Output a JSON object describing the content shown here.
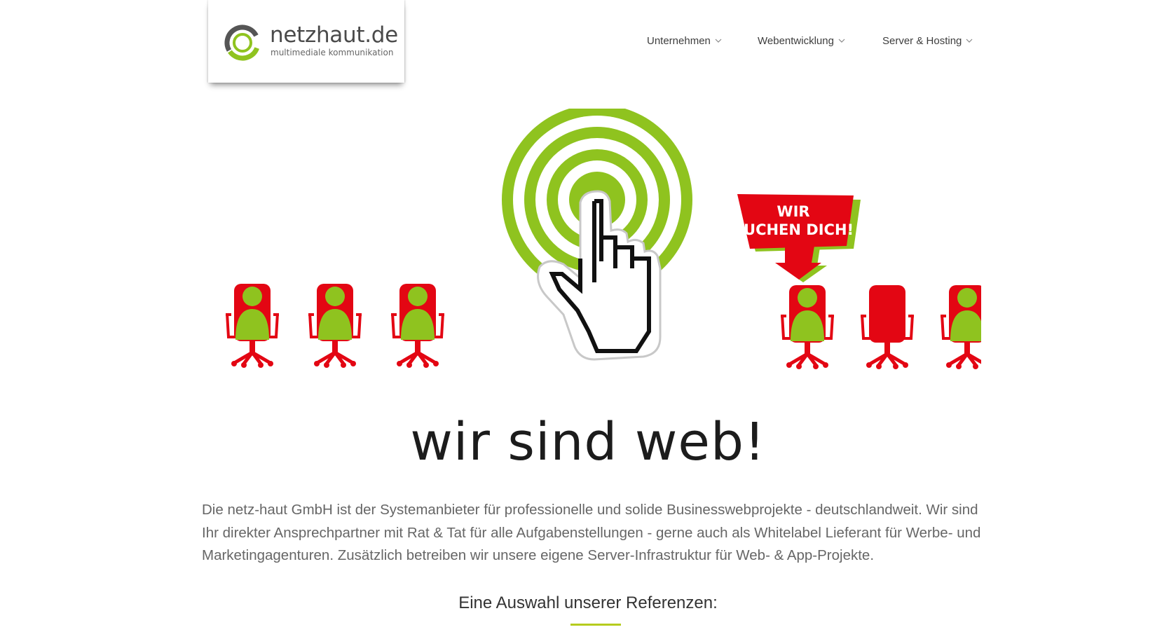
{
  "brand": {
    "name": "netzhaut.de",
    "tagline": "multimediale kommunikation"
  },
  "nav": {
    "items": [
      {
        "label": "Unternehmen"
      },
      {
        "label": "Webentwicklung"
      },
      {
        "label": "Server & Hosting"
      }
    ]
  },
  "hero": {
    "badge_line1": "WIR",
    "badge_line2": "SUCHEN DICH!",
    "tagline": "wir sind web!"
  },
  "intro": {
    "text": "Die netz-haut GmbH ist der Systemanbieter für professionelle und solide Businesswebprojekte - deutschlandweit. Wir sind Ihr direkter Ansprechpartner mit Rat & Tat für alle Aufgabenstellungen - gerne auch als Whitelabel Lieferant für Werbe- und Marketingagenturen. Zusätzlich betreiben wir unsere eigene Server-Infrastruktur für Web- & App-Projekte."
  },
  "references": {
    "title": "Eine Auswahl unserer Referenzen:"
  },
  "colors": {
    "accent_green": "#8fc31f",
    "chair_red": "#e30613",
    "rule_green": "#b6cc1e"
  }
}
